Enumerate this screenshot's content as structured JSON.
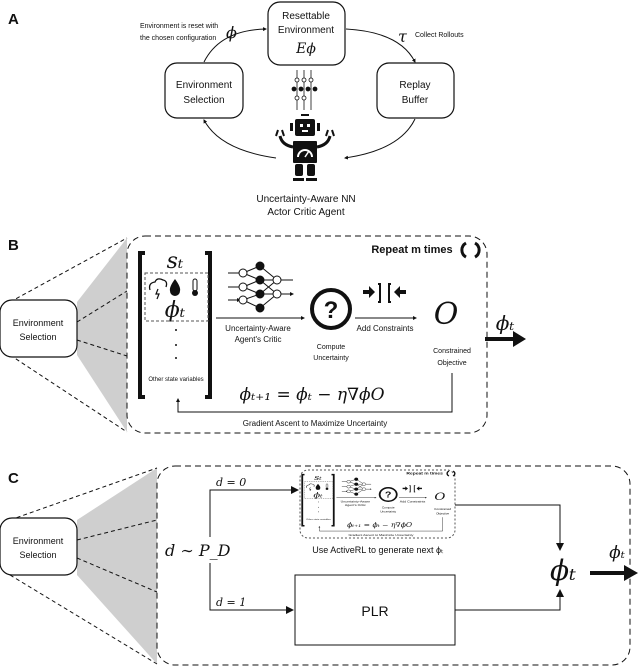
{
  "panel_a": {
    "label": "A",
    "resettable_env": [
      "Resettable",
      "Environment"
    ],
    "resettable_env_symbol": "Eϕ",
    "env_selection": [
      "Environment",
      "Selection"
    ],
    "replay_buffer": [
      "Replay",
      "Buffer"
    ],
    "reset_note": [
      "Environment is reset with",
      "the chosen configuration"
    ],
    "phi": "ϕ",
    "tau": "τ",
    "collect_rollouts": "Collect Rollouts",
    "agent_caption": [
      "Uncertainty-Aware NN",
      "Actor Critic Agent"
    ]
  },
  "panel_b": {
    "label": "B",
    "env_selection": [
      "Environment",
      "Selection"
    ],
    "state": "sₜ",
    "phi_t": "ϕₜ",
    "other_state": "Other state variables",
    "critic_label": [
      "Uncertainty-Aware",
      "Agent's Critic"
    ],
    "compute_uncertainty": [
      "Compute",
      "Uncertainty"
    ],
    "add_constraints": "Add Constraints",
    "objective": "O",
    "constrained_objective": [
      "Constrained",
      "Objective"
    ],
    "update_equation": "ϕₜ₊₁ = ϕₜ − η∇ϕO",
    "gradient_ascent": "Gradient Ascent to Maximize Uncertainty",
    "repeat": "Repeat m times",
    "output": "ϕₜ"
  },
  "panel_c": {
    "label": "C",
    "env_selection": [
      "Environment",
      "Selection"
    ],
    "distribution": "d ∼ P_D",
    "d0": "d = 0",
    "d1": "d = 1",
    "activerl_caption": "Use ActiveRL to generate next ϕₜ",
    "plr": "PLR",
    "phi_t": "ϕₜ",
    "output": "ϕₜ"
  }
}
